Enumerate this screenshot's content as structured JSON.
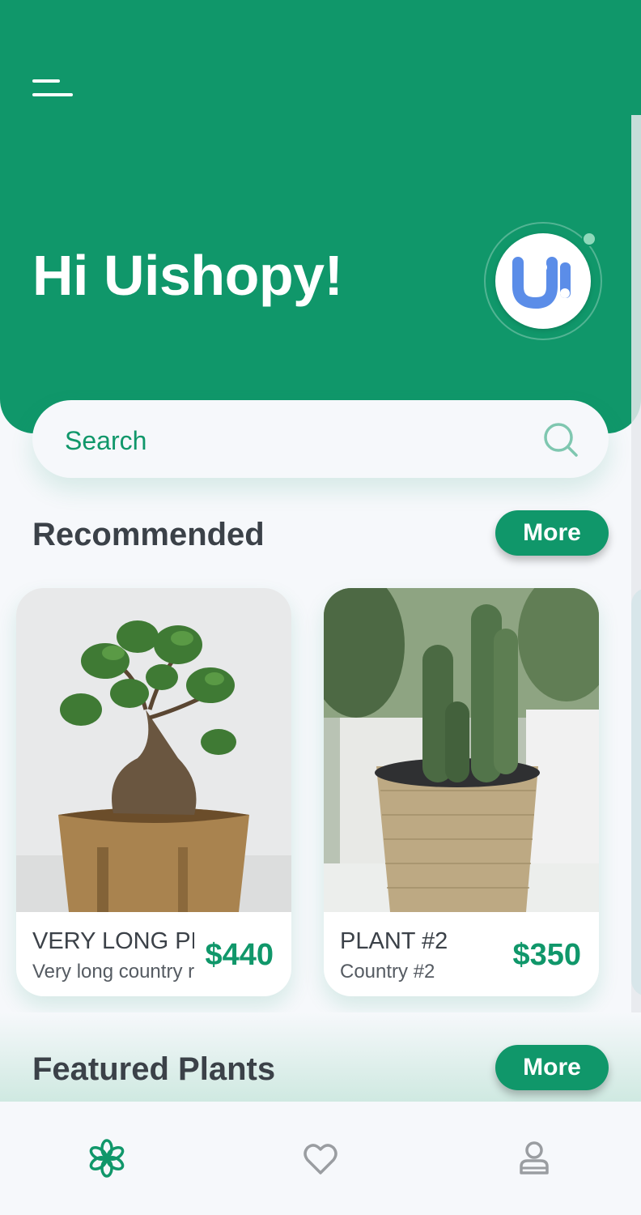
{
  "header": {
    "greeting": "Hi Uishopy!",
    "menu_icon": "hamburger-menu-icon",
    "avatar_icon": "ui-logo-avatar"
  },
  "search": {
    "placeholder": "Search",
    "icon": "search-icon"
  },
  "recommended": {
    "title": "Recommended",
    "more_label": "More",
    "items": [
      {
        "name": "VERY LONG PL",
        "country": "Very long country r",
        "price": "$440",
        "image": "bonsai-plant-in-wooden-pot"
      },
      {
        "name": "PLANT #2",
        "country": "Country #2",
        "price": "$350",
        "image": "cactus-in-rope-pot"
      }
    ]
  },
  "featured": {
    "title": "Featured Plants",
    "more_label": "More"
  },
  "bottom_nav": [
    {
      "icon": "flower-icon",
      "active": true
    },
    {
      "icon": "heart-icon",
      "active": false
    },
    {
      "icon": "user-icon",
      "active": false
    }
  ],
  "colors": {
    "primary": "#10976a",
    "text": "#3b4148",
    "background": "#f6f8fb",
    "inactive_icon": "#9a9da1"
  }
}
